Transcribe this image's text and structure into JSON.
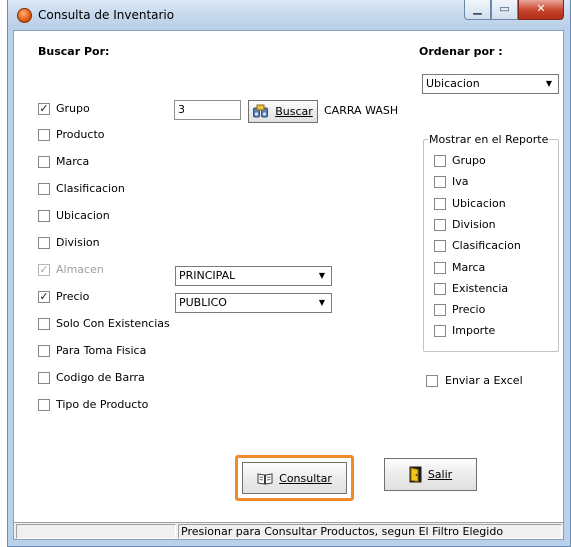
{
  "window": {
    "title": "Consulta de Inventario",
    "minimize": "▁",
    "maximize": "▭",
    "close": "✕"
  },
  "search": {
    "heading": "Buscar Por:",
    "criteria": [
      {
        "label": "Grupo",
        "checked": true,
        "disabled": false
      },
      {
        "label": "Producto",
        "checked": false,
        "disabled": false
      },
      {
        "label": "Marca",
        "checked": false,
        "disabled": false
      },
      {
        "label": "Clasificacion",
        "checked": false,
        "disabled": false
      },
      {
        "label": "Ubicacion",
        "checked": false,
        "disabled": false
      },
      {
        "label": "Division",
        "checked": false,
        "disabled": false
      },
      {
        "label": "Almacen",
        "checked": true,
        "disabled": true
      },
      {
        "label": "Precio",
        "checked": true,
        "disabled": false
      },
      {
        "label": "Solo Con Existencias",
        "checked": false,
        "disabled": false
      },
      {
        "label": "Para Toma Fisica",
        "checked": false,
        "disabled": false
      },
      {
        "label": "Codigo de Barra",
        "checked": false,
        "disabled": false
      },
      {
        "label": "Tipo de Producto",
        "checked": false,
        "disabled": false
      }
    ],
    "grupo_value": "3",
    "buscar_label": "Buscar",
    "grupo_result": "CARRA WASH",
    "almacen_value": "PRINCIPAL",
    "precio_value": "PUBLICO"
  },
  "order": {
    "heading": "Ordenar por :",
    "value": "Ubicacion"
  },
  "report": {
    "title": "Mostrar en el Reporte",
    "columns": [
      {
        "label": "Grupo",
        "checked": false
      },
      {
        "label": "Iva",
        "checked": false
      },
      {
        "label": "Ubicacion",
        "checked": false
      },
      {
        "label": "Division",
        "checked": false
      },
      {
        "label": "Clasificacion",
        "checked": false
      },
      {
        "label": "Marca",
        "checked": false
      },
      {
        "label": "Existencia",
        "checked": false
      },
      {
        "label": "Precio",
        "checked": false
      },
      {
        "label": "Importe",
        "checked": false
      }
    ],
    "excel_label": "Enviar a Excel"
  },
  "actions": {
    "consultar": "Consultar",
    "salir": "Salir"
  },
  "status": {
    "message": "Presionar para Consultar Productos, segun El Filtro Elegido"
  },
  "icons": {
    "check": "✓",
    "dropdown": "▼"
  },
  "colors": {
    "highlight": "#f08b2b",
    "title_bar": "#c3d6ec",
    "close_button": "#c8432c"
  }
}
